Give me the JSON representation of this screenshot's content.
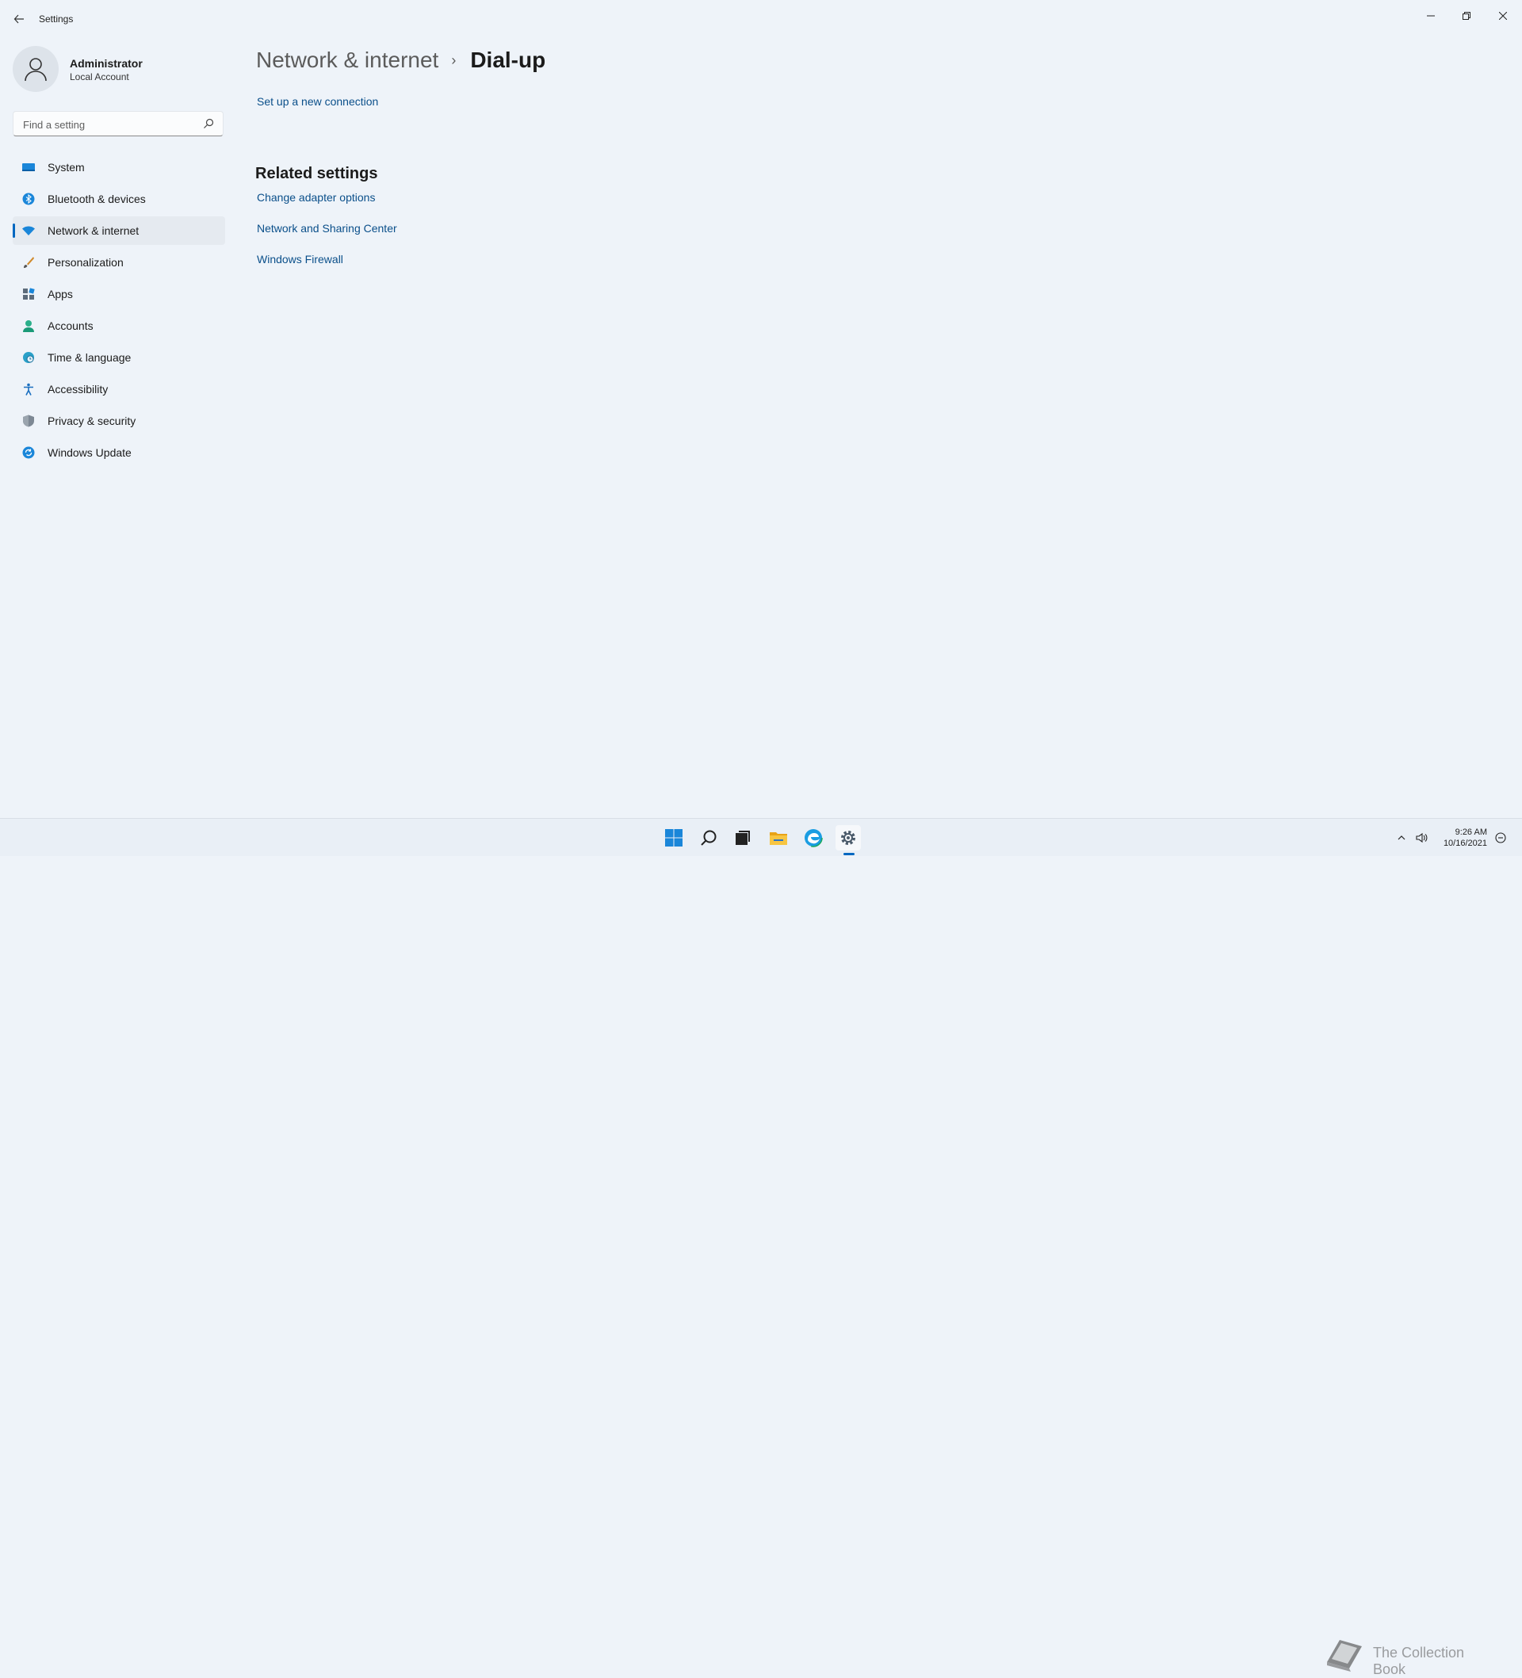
{
  "window": {
    "title": "Settings",
    "back_icon": "back-arrow-icon",
    "minimize_icon": "minimize-icon",
    "maximize_icon": "restore-icon",
    "close_icon": "close-icon"
  },
  "profile": {
    "name": "Administrator",
    "account_type": "Local Account",
    "avatar_icon": "person-icon"
  },
  "search": {
    "placeholder": "Find a setting",
    "value": "",
    "icon": "search-icon"
  },
  "sidebar": {
    "items": [
      {
        "label": "System",
        "icon": "system-icon",
        "active": false
      },
      {
        "label": "Bluetooth & devices",
        "icon": "bluetooth-icon",
        "active": false
      },
      {
        "label": "Network & internet",
        "icon": "wifi-icon",
        "active": true
      },
      {
        "label": "Personalization",
        "icon": "brush-icon",
        "active": false
      },
      {
        "label": "Apps",
        "icon": "apps-icon",
        "active": false
      },
      {
        "label": "Accounts",
        "icon": "account-icon",
        "active": false
      },
      {
        "label": "Time & language",
        "icon": "globe-clock-icon",
        "active": false
      },
      {
        "label": "Accessibility",
        "icon": "accessibility-icon",
        "active": false
      },
      {
        "label": "Privacy & security",
        "icon": "shield-icon",
        "active": false
      },
      {
        "label": "Windows Update",
        "icon": "update-icon",
        "active": false
      }
    ]
  },
  "main": {
    "breadcrumb_parent": "Network & internet",
    "breadcrumb_separator": "›",
    "breadcrumb_current": "Dial-up",
    "setup_link": "Set up a new connection",
    "related_title": "Related settings",
    "related_links": [
      "Change adapter options",
      "Network and Sharing Center",
      "Windows Firewall"
    ]
  },
  "taskbar": {
    "apps": [
      "start-icon",
      "search-icon",
      "task-view-icon",
      "file-explorer-icon",
      "edge-icon",
      "settings-icon"
    ],
    "active_app": "settings-icon",
    "time": "9:26 AM",
    "date": "10/16/2021",
    "tray_icons": [
      "chevron-up-icon",
      "speaker-icon",
      "notification-icon"
    ]
  },
  "watermark": {
    "text": "The Collection Book"
  },
  "colors": {
    "accent": "#0067c0",
    "link": "#0a4f8a",
    "background": "#eef3f9"
  }
}
